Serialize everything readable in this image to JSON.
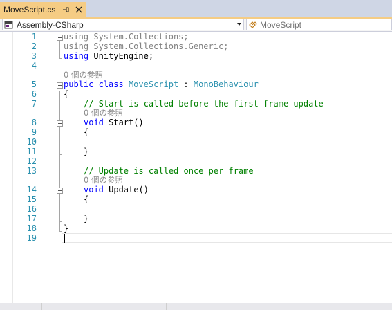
{
  "tab": {
    "title": "MoveScript.cs",
    "pin_icon": "pin-icon",
    "close_icon": "close-icon"
  },
  "nav": {
    "project": "Assembly-CSharp",
    "type": "MoveScript"
  },
  "refs": "0 個の参照",
  "line_numbers": [
    "1",
    "2",
    "3",
    "4",
    "5",
    "6",
    "7",
    "8",
    "9",
    "10",
    "11",
    "12",
    "13",
    "14",
    "15",
    "16",
    "17",
    "18",
    "19"
  ],
  "code": {
    "l1_using": "using",
    "l1_ns": " System.Collections;",
    "l2_using": "using",
    "l2_ns": " System.Collections.Generic;",
    "l3_using": "using",
    "l3_ns": " UnityEngine;",
    "l5_public": "public",
    "l5_class": "class",
    "l5_name": "MoveScript",
    "l5_colon": " : ",
    "l5_base": "MonoBehaviour",
    "l6": "{",
    "l7_comment": "// Start is called before the first frame update",
    "l8_void": "void",
    "l8_name": " Start()",
    "l9": "{",
    "l11": "}",
    "l13_comment": "// Update is called once per frame",
    "l14_void": "void",
    "l14_name": " Update()",
    "l15": "{",
    "l17": "}",
    "l18": "}"
  }
}
